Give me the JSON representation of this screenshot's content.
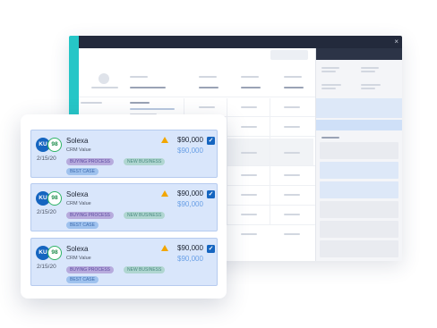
{
  "window": {
    "close_glyph": "×"
  },
  "deals": [
    {
      "owner_initials": "KU",
      "score": "98",
      "date": "2/15/20",
      "name": "Solexa",
      "subtitle": "CRM Value",
      "amount": "$90,000",
      "crm_amount": "$90,000",
      "checked": true,
      "tags": [
        "BUYING PROCESS",
        "NEW BUSINESS",
        "BEST CASE"
      ]
    },
    {
      "owner_initials": "KU",
      "score": "98",
      "date": "2/15/20",
      "name": "Solexa",
      "subtitle": "CRM Value",
      "amount": "$90,000",
      "crm_amount": "$90,000",
      "checked": true,
      "tags": [
        "BUYING PROCESS",
        "NEW BUSINESS",
        "BEST CASE"
      ]
    },
    {
      "owner_initials": "KU",
      "score": "98",
      "date": "2/15/20",
      "name": "Solexa",
      "subtitle": "CRM Value",
      "amount": "$90,000",
      "crm_amount": "$90,000",
      "checked": true,
      "tags": [
        "BUYING PROCESS",
        "NEW BUSINESS",
        "BEST CASE"
      ]
    }
  ],
  "colors": {
    "accent": "#26c6c7",
    "title_bar": "#232a3c",
    "owner_badge": "#1565c0",
    "score_ring": "#2fb366",
    "warning": "#f2a600",
    "card_bg": "#d9e6fb"
  },
  "icons": {
    "close": "close-icon",
    "warning": "warning-icon",
    "checkbox": "checkbox-checked-icon"
  }
}
